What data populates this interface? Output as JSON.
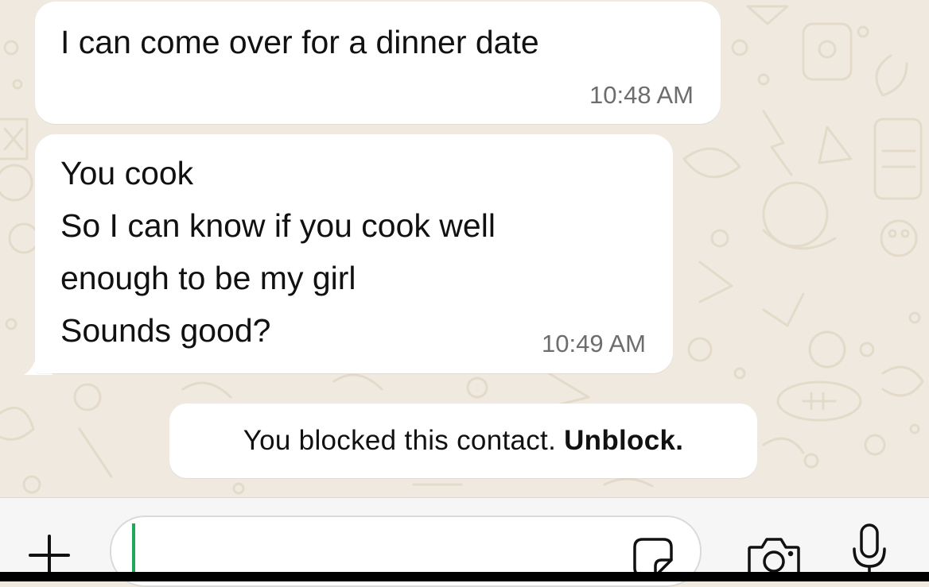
{
  "colors": {
    "wallpaper": "#efe9df",
    "wallpaper_doodle": "#e4dac9",
    "bubble": "#ffffff",
    "text": "#111111",
    "timestamp": "#6d6d6d",
    "caret": "#1faa59",
    "input_bar": "#f6f6f6"
  },
  "messages": [
    {
      "lines": [
        "I can come over for a dinner date"
      ],
      "time": "10:48 AM"
    },
    {
      "lines": [
        "You cook",
        "So I can know if you cook well",
        "enough to be my girl",
        "Sounds good?"
      ],
      "time": "10:49 AM"
    }
  ],
  "system_note": {
    "text": "You blocked this contact.",
    "action": "Unblock."
  },
  "input_bar": {
    "value": "",
    "placeholder": "",
    "icons": [
      "plus-icon",
      "sticker-icon",
      "camera-icon",
      "microphone-icon"
    ]
  }
}
